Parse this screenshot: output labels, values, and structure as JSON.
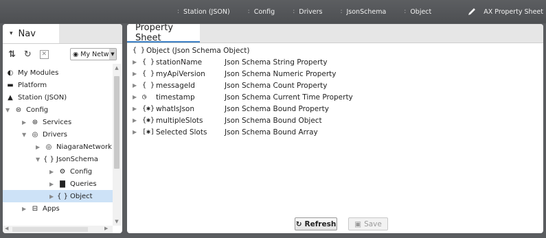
{
  "breadcrumb": [
    {
      "label": "Station (JSON)"
    },
    {
      "label": "Config"
    },
    {
      "label": "Drivers"
    },
    {
      "label": "JsonSchema"
    },
    {
      "label": "Object"
    }
  ],
  "view_selector": {
    "label": "AX Property Sheet",
    "icon": "pencil-icon"
  },
  "nav": {
    "tab_label": "Nav",
    "select_value": "My Netw",
    "tree": [
      {
        "label": "My Modules",
        "icon": "modules-icon"
      },
      {
        "label": "Platform",
        "icon": "platform-icon"
      },
      {
        "label": "Station (JSON)",
        "icon": "station-icon"
      },
      {
        "label": "Config",
        "icon": "config-icon"
      },
      {
        "label": "Services",
        "icon": "services-icon"
      },
      {
        "label": "Drivers",
        "icon": "drivers-icon"
      },
      {
        "label": "NiagaraNetwork",
        "icon": "network-icon"
      },
      {
        "label": "JsonSchema",
        "icon": "braces-icon"
      },
      {
        "label": "Config",
        "icon": "config-gear-icon"
      },
      {
        "label": "Queries",
        "icon": "folder-icon"
      },
      {
        "label": "Object",
        "icon": "braces-icon"
      },
      {
        "label": "Apps",
        "icon": "apps-icon"
      }
    ]
  },
  "sheet": {
    "tab_label": "Property Sheet",
    "root": {
      "icon": "{ }",
      "label": "Object  (Json Schema Object)"
    },
    "properties": [
      {
        "icon": "{ }",
        "name": "stationName",
        "type": "Json Schema String Property"
      },
      {
        "icon": "{ }",
        "name": "myApiVersion",
        "type": "Json Schema Numeric Property"
      },
      {
        "icon": "{ }",
        "name": "messageId",
        "type": "Json Schema Count Property"
      },
      {
        "icon": "◷",
        "name": "timestamp",
        "type": "Json Schema Current Time Property"
      },
      {
        "icon": "{✱}",
        "name": "whatIsJson",
        "type": "Json Schema Bound Property"
      },
      {
        "icon": "{✱}",
        "name": "multipleSlots",
        "type": "Json Schema Bound Object"
      },
      {
        "icon": "[✱]",
        "name": "Selected Slots",
        "type": "Json Schema Bound Array"
      }
    ],
    "refresh_label": "Refresh",
    "save_label": "Save"
  }
}
